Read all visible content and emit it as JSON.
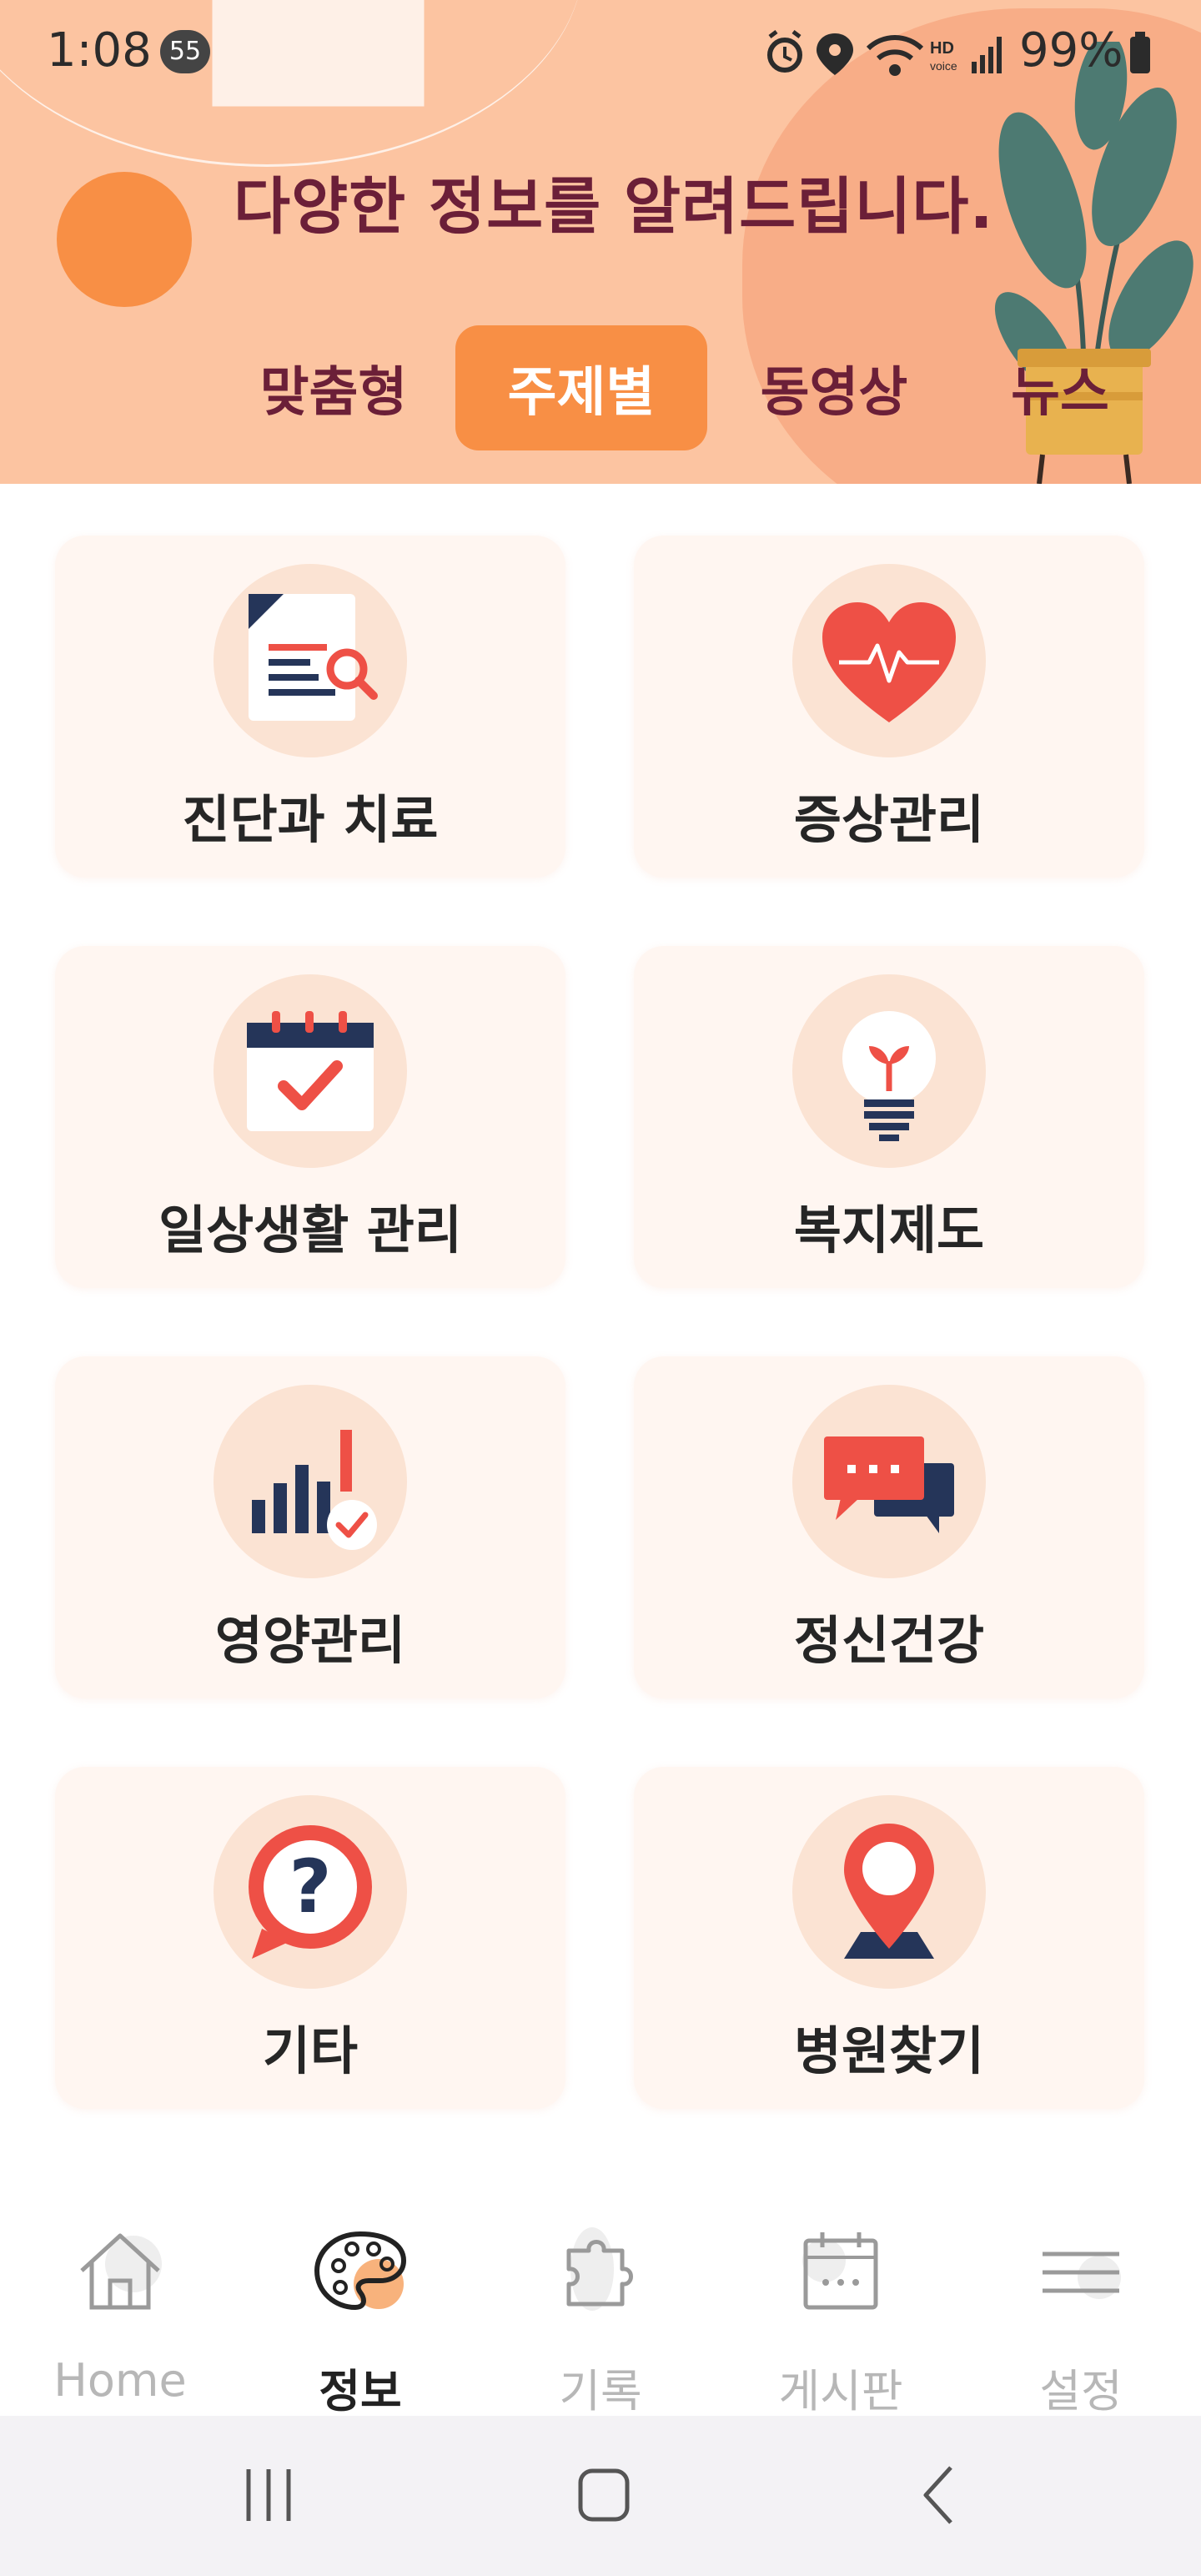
{
  "status_bar": {
    "time": "1:08",
    "notification_count": "55",
    "battery": "99%"
  },
  "header": {
    "title": "다양한 정보를 알려드립니다."
  },
  "tabs": [
    {
      "label": "맞춤형",
      "active": false
    },
    {
      "label": "주제별",
      "active": true
    },
    {
      "label": "동영상",
      "active": false
    },
    {
      "label": "뉴스",
      "active": false
    }
  ],
  "topics": [
    {
      "label": "진단과 치료",
      "icon": "document-search-icon"
    },
    {
      "label": "증상관리",
      "icon": "heart-pulse-icon"
    },
    {
      "label": "일상생활 관리",
      "icon": "calendar-check-icon"
    },
    {
      "label": "복지제도",
      "icon": "lightbulb-sprout-icon"
    },
    {
      "label": "영양관리",
      "icon": "bar-chart-check-icon"
    },
    {
      "label": "정신건강",
      "icon": "chat-bubbles-icon"
    },
    {
      "label": "기타",
      "icon": "question-bubble-icon"
    },
    {
      "label": "병원찾기",
      "icon": "map-pin-icon"
    }
  ],
  "bottom_nav": [
    {
      "label": "Home",
      "icon": "home-icon",
      "active": false
    },
    {
      "label": "정보",
      "icon": "palette-icon",
      "active": true
    },
    {
      "label": "기록",
      "icon": "puzzle-icon",
      "active": false
    },
    {
      "label": "게시판",
      "icon": "calendar-board-icon",
      "active": false
    },
    {
      "label": "설정",
      "icon": "menu-icon",
      "active": false
    }
  ],
  "colors": {
    "header_bg": "#fcc4a1",
    "accent": "#f88f45",
    "title_text": "#6b1f38",
    "card_bg": "#fff6f1",
    "icon_circle": "#fbe3d3",
    "icon_red": "#ee5046",
    "icon_navy": "#253559"
  }
}
